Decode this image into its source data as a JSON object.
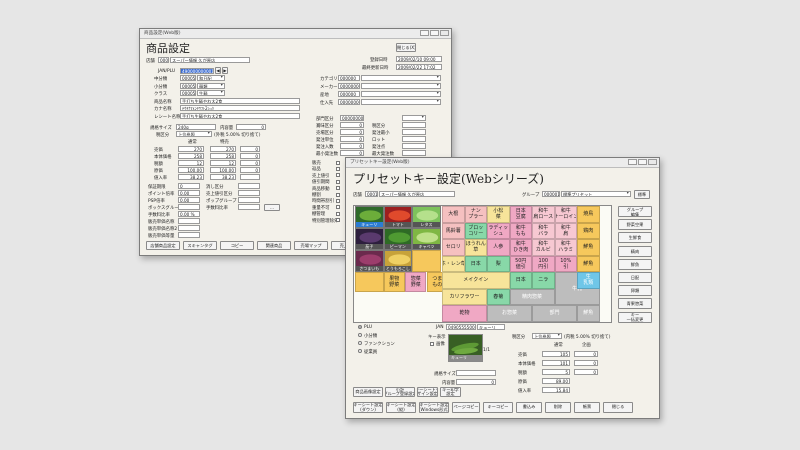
{
  "back": {
    "window_title": "商品設定(Web版)",
    "title": "商品設定",
    "close_btn": "閉じる(X)",
    "store_lbl": "店舗",
    "store_code": "0001",
    "store_name": "スーパー情報 久が原店",
    "reg_date_lbl": "登録日時",
    "reg_date": "2009/02/10 09:00",
    "upd_date_lbl": "最終更新日時",
    "upd_date": "2009/02/22 17:02",
    "jan_lbl": "JAN/PLU",
    "jan_val": "4900000000018",
    "left_fields": [
      {
        "label": "中分類",
        "code": "000050",
        "name": "和日配"
      },
      {
        "label": "小分類",
        "code": "000051",
        "name": "麺類"
      },
      {
        "label": "クラス",
        "code": "000052",
        "name": "生麺"
      },
      {
        "label": "商品名称",
        "code": "",
        "name": "手打ち生麺やわ太2食"
      },
      {
        "label": "カナ名称",
        "code": "",
        "name": "ﾃｳﾁﾅﾏﾒﾝﾔﾜﾌﾄ2ｼｮｸ"
      },
      {
        "label": "レシート名称",
        "code": "",
        "name": "手打ち生麺やわ太2食"
      }
    ],
    "right_fields": [
      {
        "label": "カテゴリ",
        "code": "000000"
      },
      {
        "label": "メーカー",
        "code": "000000000"
      },
      {
        "label": "産地",
        "code": "000000"
      },
      {
        "label": "仕入先",
        "code": "000000000"
      }
    ],
    "size_lbl": "規格サイズ",
    "size_val": "240g",
    "content_lbl": "内容量",
    "content_val": "0",
    "tax_lbl": "税区分",
    "tax_val": "上位参照",
    "tax_note": "(外税 5.00% 切り捨て)",
    "col_normal": "通常",
    "col_special": "特売",
    "price_rows": [
      {
        "label": "売価",
        "a": "270",
        "b": "270",
        "c": "0"
      },
      {
        "label": "本体価格",
        "a": "258",
        "b": "258",
        "c": "0"
      },
      {
        "label": "税額",
        "a": "12",
        "b": "12",
        "c": "0"
      },
      {
        "label": "原価",
        "a": "100.00",
        "b": "100.00",
        "c": "0"
      },
      {
        "label": "値入率",
        "a": "38.23",
        "b": "38.23",
        "c": ""
      }
    ],
    "misc": [
      {
        "label": "保証期限",
        "val": "0"
      },
      {
        "label": "ポイント倍率",
        "val": "0.00"
      },
      {
        "label": "PSP倍率",
        "val": "0.00"
      },
      {
        "label": "ボックスグループ",
        "val": ""
      },
      {
        "label": "手数料比率",
        "val": "0.00 %"
      },
      {
        "label": "販売単価名称",
        "val": ""
      },
      {
        "label": "販売単価名称2",
        "val": ""
      },
      {
        "label": "販売単価等量",
        "val": ""
      }
    ],
    "misc2": [
      "消し区分",
      "売上値引区分",
      "ポップグループ",
      "手数料比率"
    ],
    "misc2_vals": [
      "0",
      "0.00 %"
    ],
    "mid_rows": [
      "部門区分",
      "賞味区分",
      "売場区分",
      "発注単位",
      "発注入数",
      "最小発注数"
    ],
    "mid_vals": [
      "00000000",
      "0",
      "0",
      "0",
      "0",
      "0"
    ],
    "mid2_lbls": [
      "税区分",
      "発注最小",
      "ロット",
      "発注点",
      "最大発注数"
    ],
    "lower_checks": [
      "販売",
      "返品",
      "売上値引",
      "値引期間",
      "商品移動",
      "棚割",
      "時間帯割引",
      "重量不可",
      "棚管理",
      "特別管理除外"
    ],
    "bottom_buttons": [
      "店舗商品設定",
      "スキャンタグ",
      "コピー",
      "関連商品",
      "売場マップ",
      "売上推移",
      "前期比較",
      "商品一覧"
    ]
  },
  "front": {
    "window_title": "プリセットキー設定(Web版)",
    "title": "プリセットキー設定(Webシリーズ)",
    "store_lbl": "店舗",
    "store_code": "0001",
    "store_name": "スーパー情報 久が原店",
    "group_lbl": "グループ",
    "group_code": "000001",
    "group_name": "標準プリセット",
    "std_btn": "標準",
    "products": [
      {
        "name": "キューリ"
      },
      {
        "name": "トマト"
      },
      {
        "name": "レタス"
      },
      {
        "name": "茄子"
      },
      {
        "name": "ピーマン"
      },
      {
        "name": "キャベツ"
      },
      {
        "name": "さつまいも"
      },
      {
        "name": "とうもろこし"
      }
    ],
    "keys": [
      [
        "大根",
        "ナン\nプラー",
        "小松\n菜",
        "日本\n豆腐",
        "和牛\n肩ロース",
        "和牛\nサーロイン",
        "焼鳥"
      ],
      [
        "馬鈴薯",
        "ブロッ\nコリー",
        "ラディッ\nシュ",
        "和牛\nもも",
        "和牛\nバラ",
        "和牛\n肩",
        "鶏肉"
      ],
      [
        "セロリ",
        "ほうれん\n草",
        "人参",
        "和牛\nひき肉",
        "和牛\nカルビ",
        "和牛\nハラミ",
        "鮮魚"
      ],
      [
        "ホ・レン草",
        "日本",
        "梨",
        "50円\n値引",
        "100\n円引",
        "10%\n引",
        "鮮魚"
      ],
      [
        "メイクイン",
        "日本",
        "ニラ",
        "",
        "",
        "",
        ""
      ],
      [
        "カリフラワー",
        "春菊",
        "",
        "",
        "",
        "",
        ""
      ],
      [
        "",
        "",
        "",
        "",
        "",
        "",
        ""
      ],
      [
        "",
        "",
        "",
        "",
        "",
        "",
        ""
      ]
    ],
    "row5_big": "牛乳",
    "row5_side": "生\n乳類",
    "row6_big": "精肉惣菜",
    "row6_mid": "玄米",
    "row7": [
      "乾物",
      "お惣菜",
      "部門",
      "鮮魚"
    ],
    "row2_cells": [
      "果物\n野菜",
      "惣菜\n野菜",
      "つま\nもの",
      "加工\n野菜"
    ],
    "side_buttons": [
      "グループ\n編集",
      "野菜空果",
      "生鮮食",
      "精肉",
      "鮮魚",
      "日配",
      "卵類",
      "青果惣菜",
      "キー\n一括変更"
    ],
    "radio": [
      "PLU",
      "小分類",
      "ファンクション",
      "従業員"
    ],
    "jan_lbl": "JAN",
    "jan_val": "0490555500318",
    "jan_name": "キューリ",
    "key_disp_lbl": "キー表示",
    "img_chk": "画像",
    "img_counter": "1/1",
    "thumb_cap": "キューリ",
    "size_lbl": "規格サイズ",
    "content_lbl": "内容量",
    "content_val": "0",
    "tax_lbl": "税区分",
    "tax_val": "上位参照",
    "tax_note": "(内税 5.00% 切り捨て)",
    "col_normal": "通常",
    "col_special": "企画",
    "prices": [
      {
        "label": "売価",
        "a": "105",
        "b": "0"
      },
      {
        "label": "本体価格",
        "a": "101",
        "b": "0"
      },
      {
        "label": "税額",
        "a": "5",
        "b": "0"
      },
      {
        "label": "原価",
        "a": "89.00",
        "b": ""
      },
      {
        "label": "値入率",
        "a": "15.84",
        "b": ""
      }
    ],
    "left_btns": [
      "商品画像設定",
      "小計\nグループ登録設定"
    ],
    "left_btns2": [
      "キーシートデ\nザイン設定",
      "キー印字\n設定"
    ],
    "bottom_buttons": [
      "キーシート設定\n(ダウン)",
      "キーシート設定\n(縦)",
      "キーシート設定\n(Windows形式)",
      "ページコピー",
      "キーコピー",
      "書込み",
      "削除",
      "帳票",
      "閉じる"
    ]
  }
}
